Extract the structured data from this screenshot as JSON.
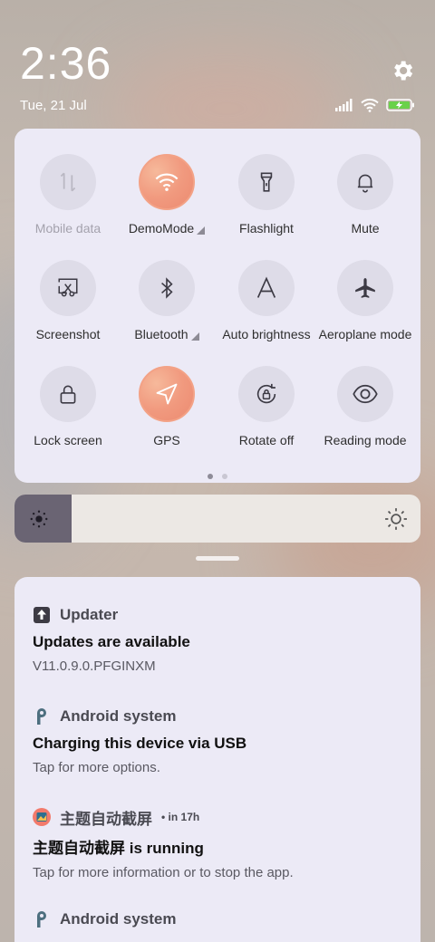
{
  "status": {
    "time": "2:36",
    "date": "Tue, 21 Jul"
  },
  "quick_settings": {
    "tiles": [
      {
        "label": "Mobile data",
        "icon": "mobile-data-icon",
        "active": false,
        "dim": true
      },
      {
        "label": "DemoMode",
        "icon": "wifi-icon",
        "active": true,
        "expand": true
      },
      {
        "label": "Flashlight",
        "icon": "flashlight-icon",
        "active": false
      },
      {
        "label": "Mute",
        "icon": "bell-icon",
        "active": false
      },
      {
        "label": "Screenshot",
        "icon": "screenshot-icon",
        "active": false
      },
      {
        "label": "Bluetooth",
        "icon": "bluetooth-icon",
        "active": false,
        "expand": true
      },
      {
        "label": "Auto brightness",
        "icon": "auto-brightness-icon",
        "active": false
      },
      {
        "label": "Aeroplane mode",
        "icon": "aeroplane-icon",
        "active": false
      },
      {
        "label": "Lock screen",
        "icon": "lock-icon",
        "active": false
      },
      {
        "label": "GPS",
        "icon": "location-icon",
        "active": true
      },
      {
        "label": "Rotate off",
        "icon": "rotate-lock-icon",
        "active": false
      },
      {
        "label": "Reading mode",
        "icon": "eye-icon",
        "active": false
      }
    ],
    "page": 1,
    "pages": 2
  },
  "brightness": {
    "level": 0.14
  },
  "notifications": [
    {
      "app": "Updater",
      "time": "",
      "title": "Updates are available",
      "text": "V11.0.9.0.PFGINXM",
      "icon": "updater-icon"
    },
    {
      "app": "Android system",
      "time": "",
      "title": "Charging this device via USB",
      "text": "Tap for more options.",
      "icon": "android-system-icon"
    },
    {
      "app": "主题自动截屏",
      "time": "• in 17h",
      "title": "主题自动截屏 is running",
      "text": "Tap for more information or to stop the app.",
      "icon": "theme-app-icon"
    },
    {
      "app": "Android system",
      "time": "",
      "title": "",
      "text": "",
      "icon": "android-system-icon"
    }
  ],
  "colors": {
    "panel": "#eceaf6",
    "active_tile": "#f19a7f",
    "battery": "#6ad14a"
  }
}
